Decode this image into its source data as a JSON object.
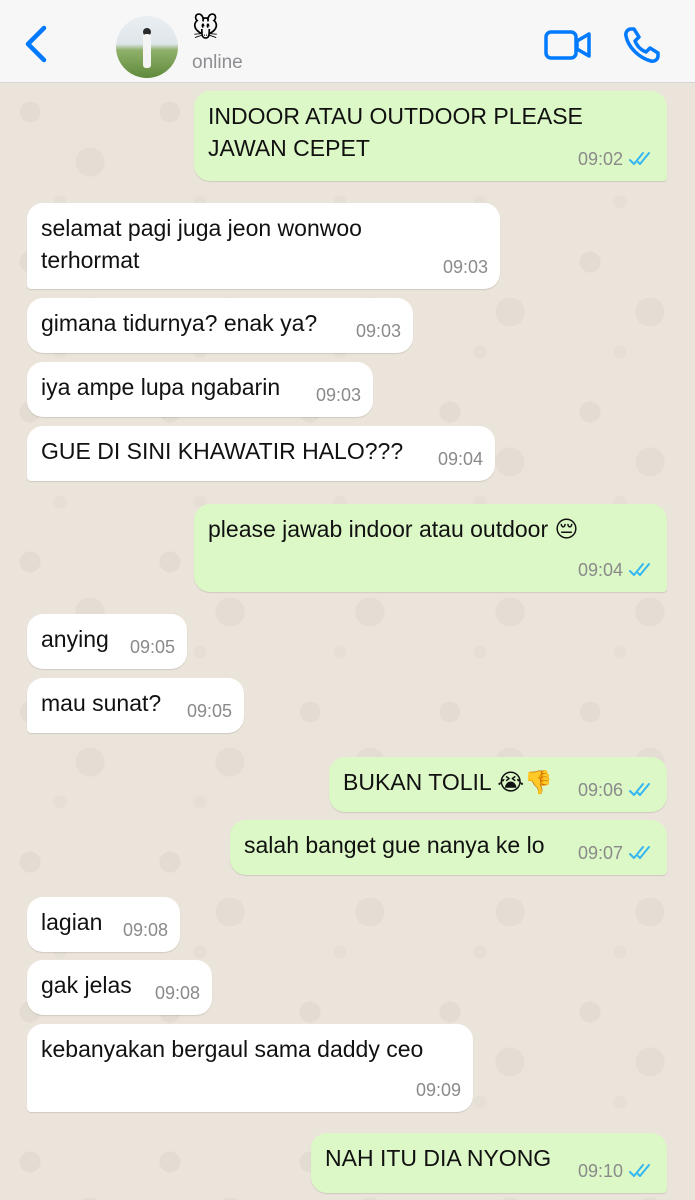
{
  "header": {
    "contact_name": "🐭",
    "status": "online"
  },
  "colors": {
    "accent": "#007aff",
    "outgoing_bubble": "#dcf8c6",
    "incoming_bubble": "#ffffff",
    "read_ticks": "#34b7f1"
  },
  "messages": [
    {
      "dir": "out",
      "lines": [
        "INDOOR ATAU OUTDOOR PLEASE",
        "JAWAN CEPET"
      ],
      "time": "09:02",
      "read": true
    },
    {
      "dir": "in",
      "lines": [
        "selamat pagi juga jeon wonwoo",
        "terhormat"
      ],
      "time": "09:03"
    },
    {
      "dir": "in",
      "lines": [
        "gimana tidurnya? enak ya?"
      ],
      "time": "09:03"
    },
    {
      "dir": "in",
      "lines": [
        "iya ampe lupa ngabarin"
      ],
      "time": "09:03"
    },
    {
      "dir": "in",
      "lines": [
        "GUE DI SINI KHAWATIR HALO???"
      ],
      "time": "09:04"
    },
    {
      "dir": "out",
      "lines": [
        "please jawab indoor atau outdoor 😔"
      ],
      "time": "09:04",
      "read": true
    },
    {
      "dir": "in",
      "lines": [
        "anying"
      ],
      "time": "09:05"
    },
    {
      "dir": "in",
      "lines": [
        "mau sunat?"
      ],
      "time": "09:05"
    },
    {
      "dir": "out",
      "lines": [
        "BUKAN TOLIL 😭👎"
      ],
      "time": "09:06",
      "read": true
    },
    {
      "dir": "out",
      "lines": [
        "salah banget gue nanya ke lo"
      ],
      "time": "09:07",
      "read": true
    },
    {
      "dir": "in",
      "lines": [
        "lagian"
      ],
      "time": "09:08"
    },
    {
      "dir": "in",
      "lines": [
        "gak jelas"
      ],
      "time": "09:08"
    },
    {
      "dir": "in",
      "lines": [
        "kebanyakan bergaul sama daddy ceo"
      ],
      "time": "09:09"
    },
    {
      "dir": "out",
      "lines": [
        "NAH ITU DIA NYONG"
      ],
      "time": "09:10",
      "read": true
    }
  ]
}
